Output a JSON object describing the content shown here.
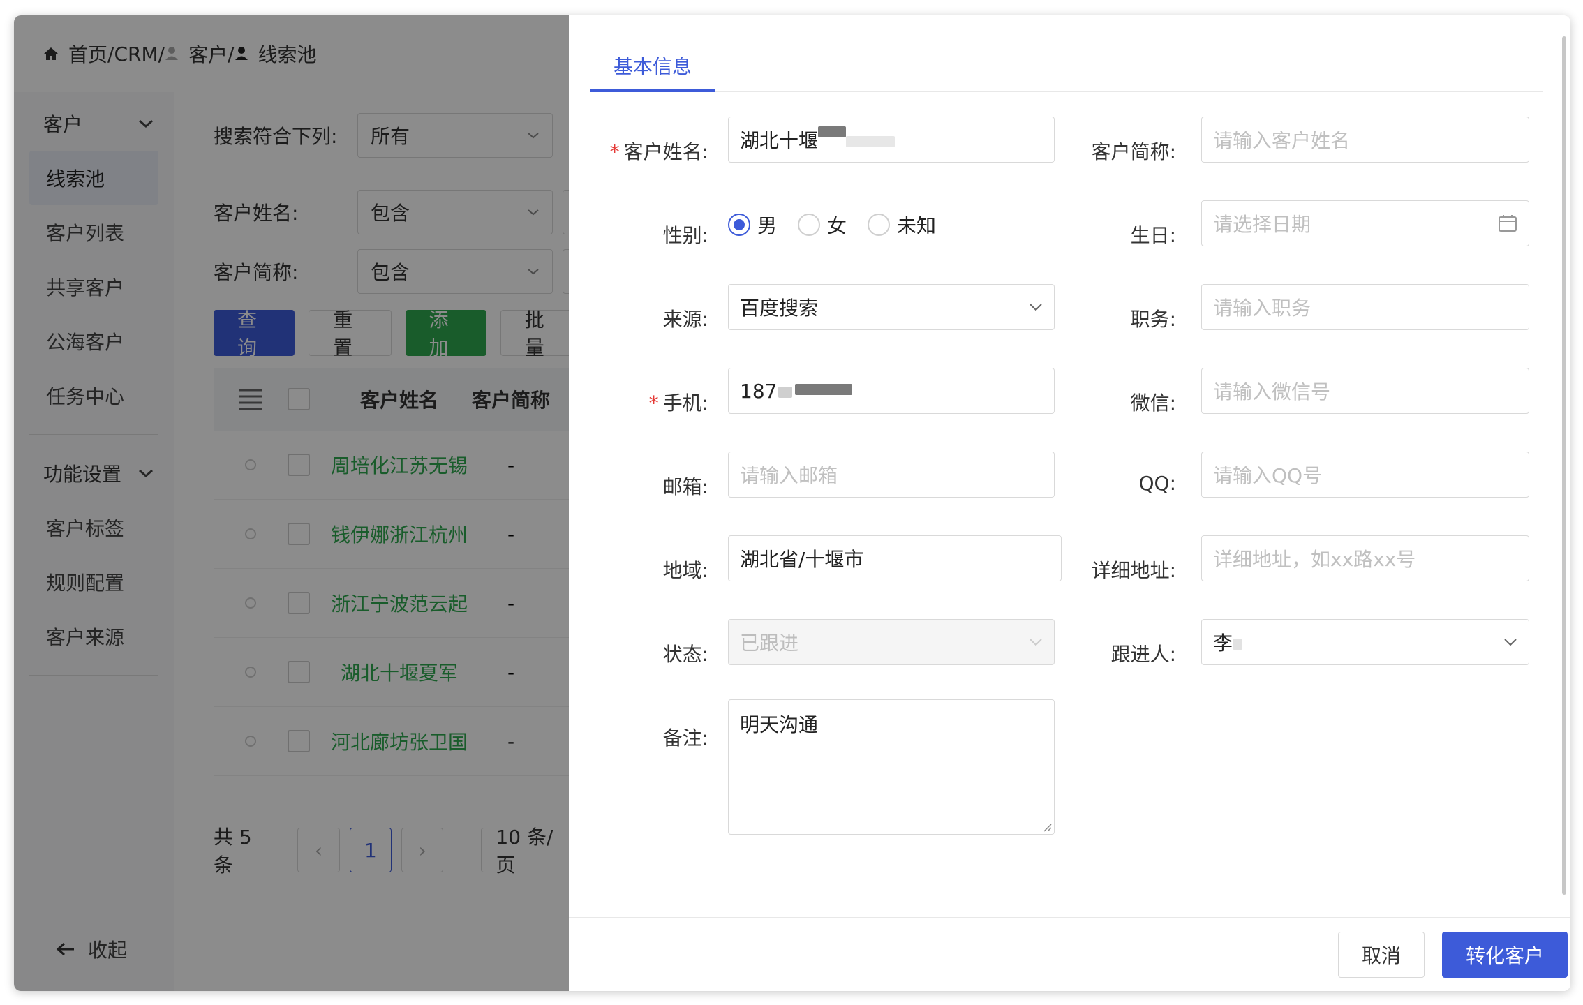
{
  "breadcrumb": {
    "home": "首页",
    "crm": "CRM",
    "customer": "客户",
    "current": "线索池"
  },
  "sidebar": {
    "group1": "客户",
    "items1": [
      "线索池",
      "客户列表",
      "共享客户",
      "公海客户",
      "任务中心"
    ],
    "group2": "功能设置",
    "items2": [
      "客户标签",
      "规则配置",
      "客户来源"
    ],
    "collapse": "收起"
  },
  "filters": [
    {
      "label": "搜索符合下列:",
      "value": "所有"
    },
    {
      "label": "客户姓名:",
      "value": "包含"
    },
    {
      "label": "客户简称:",
      "value": "包含"
    }
  ],
  "buttons": {
    "query": "查询",
    "reset": "重置",
    "add": "添加",
    "batch": "批量"
  },
  "table": {
    "headers": {
      "name": "客户姓名",
      "abbr": "客户简称"
    },
    "rows": [
      {
        "name": "周培化江苏无锡",
        "abbr": "-"
      },
      {
        "name": "钱伊娜浙江杭州",
        "abbr": "-"
      },
      {
        "name": "浙江宁波范云起",
        "abbr": "-"
      },
      {
        "name": "湖北十堰夏军",
        "abbr": "-"
      },
      {
        "name": "河北廊坊张卫国",
        "abbr": "-"
      }
    ]
  },
  "pager": {
    "total": "共 5 条",
    "page": "1",
    "size": "10 条/页"
  },
  "drawer": {
    "tab": "基本信息",
    "labels": {
      "name": "客户姓名:",
      "abbr": "客户简称:",
      "gender": "性别:",
      "birthday": "生日:",
      "source": "来源:",
      "position": "职务:",
      "phone": "手机:",
      "wechat": "微信:",
      "email": "邮箱:",
      "qq": "QQ:",
      "region": "地域:",
      "address": "详细地址:",
      "status": "状态:",
      "follower": "跟进人:",
      "remark": "备注:"
    },
    "values": {
      "name": "湖北十堰",
      "source": "百度搜索",
      "phone": "187",
      "region": "湖北省/十堰市",
      "status": "已跟进",
      "follower": "李",
      "remark": "明天沟通"
    },
    "placeholders": {
      "abbr": "请输入客户姓名",
      "birthday": "请选择日期",
      "position": "请输入职务",
      "wechat": "请输入微信号",
      "email": "请输入邮箱",
      "qq": "请输入QQ号",
      "address": "详细地址，如xx路xx号"
    },
    "gender_options": [
      "男",
      "女",
      "未知"
    ],
    "gender_selected": "男",
    "cancel": "取消",
    "submit": "转化客户"
  },
  "colors": {
    "primary": "#3d5bd9",
    "success": "#2fa84f",
    "required": "#e53935"
  }
}
